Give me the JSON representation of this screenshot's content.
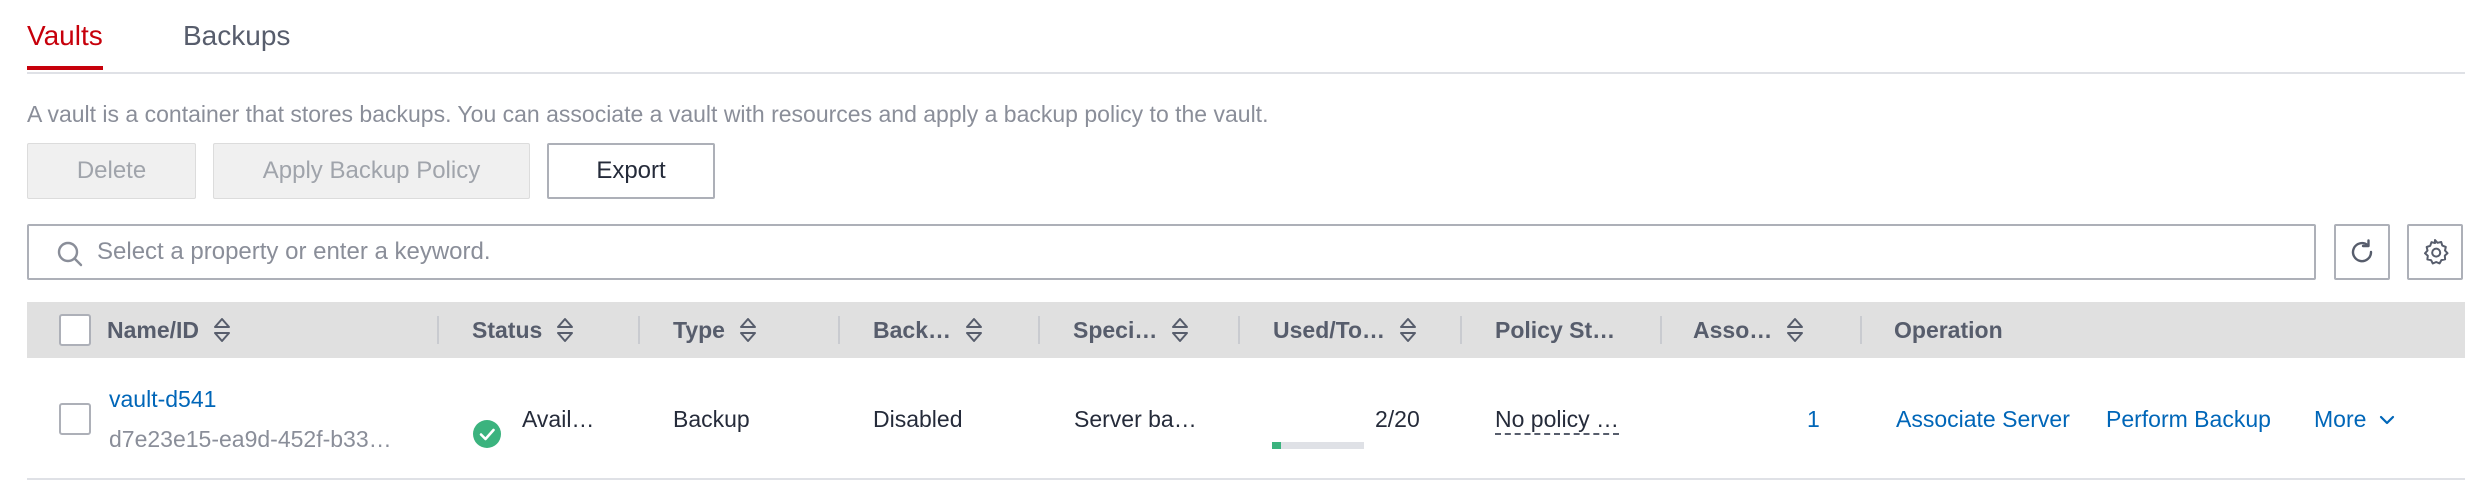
{
  "tabs": [
    {
      "label": "Vaults",
      "active": true
    },
    {
      "label": "Backups",
      "active": false
    }
  ],
  "description": "A vault is a container that stores backups. You can associate a vault with resources and apply a backup policy to the vault.",
  "toolbar": {
    "delete_label": "Delete",
    "apply_policy_label": "Apply Backup Policy",
    "export_label": "Export"
  },
  "search": {
    "placeholder": "Select a property or enter a keyword.",
    "value": ""
  },
  "table": {
    "columns": [
      "Name/ID",
      "Status",
      "Type",
      "Back…",
      "Speci…",
      "Used/To…",
      "Policy St…",
      "Asso…",
      "Operation"
    ],
    "rows": [
      {
        "name": "vault-d541",
        "id": "d7e23e15-ea9d-452f-b33…",
        "status": "Avail…",
        "type": "Backup",
        "backup": "Disabled",
        "spec": "Server ba…",
        "used_total": "2/20",
        "used_fraction": 0.1,
        "policy_status": "No policy …",
        "associated": "1",
        "operations": {
          "associate": "Associate Server",
          "perform_backup": "Perform Backup",
          "more": "More"
        }
      }
    ]
  },
  "colors": {
    "accent": "#c7000b",
    "link": "#0066b8",
    "success": "#3bb37e"
  },
  "icons": {
    "search": "search-icon",
    "refresh": "refresh-icon",
    "settings": "gear-icon",
    "sort": "sort-icon",
    "status": "check-circle-icon",
    "more": "chevron-down-icon"
  }
}
